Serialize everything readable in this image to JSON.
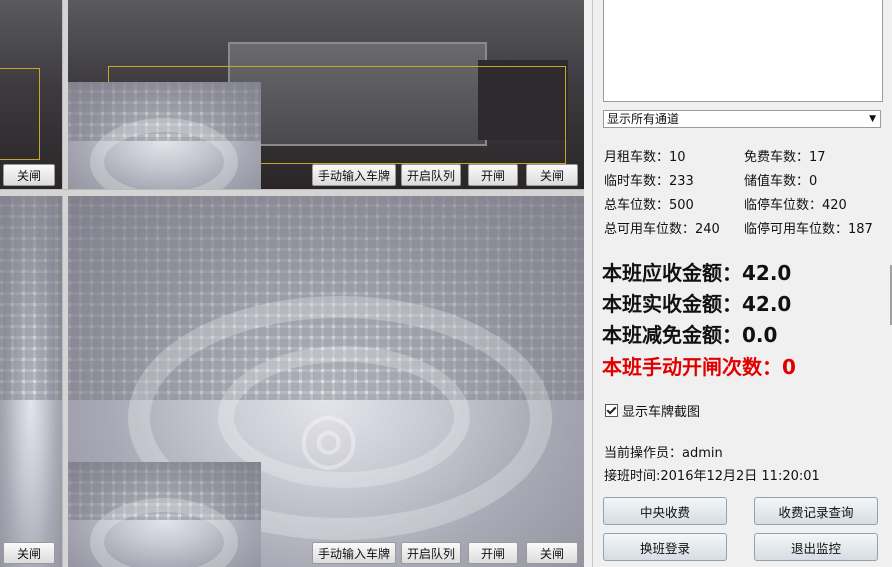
{
  "video": {
    "buttons": {
      "close": "关闸",
      "manual_plate": "手动输入车牌",
      "open_queue": "开启队列",
      "open": "开闸"
    }
  },
  "side": {
    "channel_select": "显示所有通道",
    "stats": {
      "monthly_label": "月租车数：",
      "monthly_value": "10",
      "free_label": "免费车数：",
      "free_value": "17",
      "temp_label": "临时车数：",
      "temp_value": "233",
      "stored_label": "储值车数：",
      "stored_value": "0",
      "total_spaces_label": "总车位数：",
      "total_spaces_value": "500",
      "temp_spaces_label": "临停车位数：",
      "temp_spaces_value": "420",
      "total_avail_label": "总可用车位数：",
      "total_avail_value": "240",
      "temp_avail_label": "临停可用车位数：",
      "temp_avail_value": "187"
    },
    "summary": {
      "receivable": "本班应收金额：42.0",
      "received": "本班实收金额：42.0",
      "waived": "本班减免金额：0.0",
      "manual_open": "本班手动开闸次数：0"
    },
    "show_plate_snapshot": "显示车牌截图",
    "operator": "当前操作员：admin",
    "shift_time": "接班时间:2016年12月2日 11:20:01",
    "buttons": {
      "central_charge": "中央收费",
      "charge_query": "收费记录查询",
      "shift_login": "换班登录",
      "exit_monitor": "退出监控"
    }
  }
}
